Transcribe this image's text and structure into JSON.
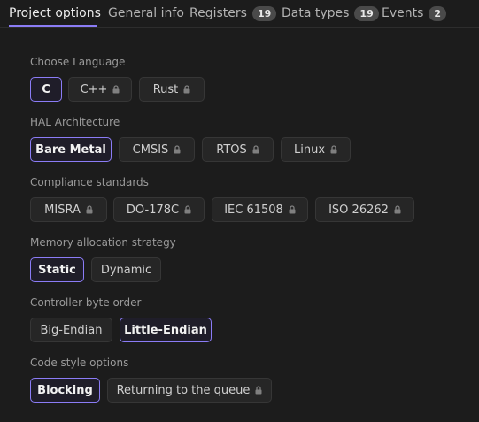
{
  "tabs": [
    {
      "label": "Project options",
      "active": true
    },
    {
      "label": "General info"
    },
    {
      "label": "Registers",
      "badge": "19"
    },
    {
      "label": "Data types",
      "badge": "19"
    },
    {
      "label": "Events",
      "badge": "2"
    }
  ],
  "sections": [
    {
      "label": "Choose Language",
      "options": [
        {
          "label": "C",
          "selected": true
        },
        {
          "label": "C++",
          "icon": "lock-icon"
        },
        {
          "label": "Rust",
          "icon": "lock-icon"
        }
      ]
    },
    {
      "label": "HAL Architecture",
      "options": [
        {
          "label": "Bare Metal",
          "selected": true
        },
        {
          "label": "CMSIS",
          "icon": "lock-icon"
        },
        {
          "label": "RTOS",
          "icon": "lock-icon"
        },
        {
          "label": "Linux",
          "icon": "lock-icon"
        }
      ]
    },
    {
      "label": "Compliance standards",
      "options": [
        {
          "label": "MISRA",
          "icon": "lock-icon"
        },
        {
          "label": "DO-178C",
          "icon": "lock-icon"
        },
        {
          "label": "IEC 61508",
          "icon": "lock-icon"
        },
        {
          "label": "ISO 26262",
          "icon": "lock-icon"
        }
      ]
    },
    {
      "label": "Memory allocation strategy",
      "options": [
        {
          "label": "Static",
          "selected": true
        },
        {
          "label": "Dynamic"
        }
      ]
    },
    {
      "label": "Controller byte order",
      "options": [
        {
          "label": "Big-Endian"
        },
        {
          "label": "Little-Endian",
          "selected": true
        }
      ]
    },
    {
      "label": "Code style options",
      "options": [
        {
          "label": "Blocking",
          "selected": true
        },
        {
          "label": "Returning to the queue",
          "icon": "lock-icon"
        }
      ]
    }
  ],
  "colors": {
    "background": "#1c1c1c",
    "accent": "#8b7cf6",
    "chip_bg": "#262626",
    "badge_bg": "#4a4a4a"
  }
}
